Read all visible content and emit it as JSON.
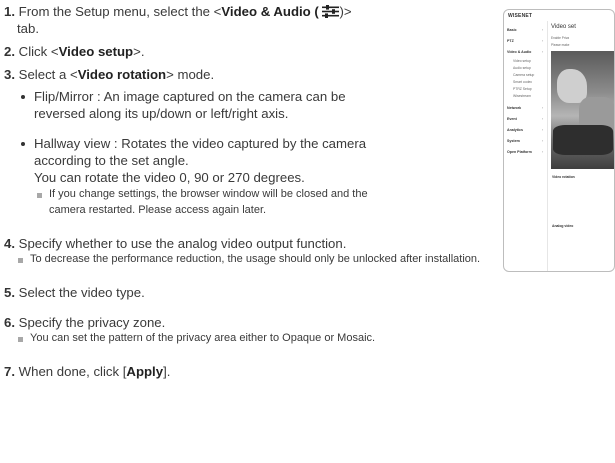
{
  "steps": [
    {
      "num": "1.",
      "pre": "From the Setup menu, select the <",
      "bold": "Video & Audio ( ",
      "post": ")>",
      "cont": "tab."
    },
    {
      "num": "2.",
      "pre": "Click <",
      "bold": "Video setup",
      "post": ">."
    },
    {
      "num": "3.",
      "pre": "Select a <",
      "bold": "Video rotation",
      "post": "> mode."
    },
    {
      "num": "4.",
      "text": "Specify whether to use the analog video output function."
    },
    {
      "num": "5.",
      "text": "Select the video type."
    },
    {
      "num": "6.",
      "text": "Specify the privacy zone."
    },
    {
      "num": "7.",
      "pre": "When done, click [",
      "bold": "Apply",
      "post": "]."
    }
  ],
  "bullets": [
    {
      "line1": "Flip/Mirror : An image captured on the camera can be",
      "line2": "reversed along its up/down or left/right axis."
    },
    {
      "line1": "Hallway view : Rotates the video captured by the camera",
      "line2": "according to the set angle.",
      "line3": "You can rotate the video 0, 90 or 270 degrees."
    }
  ],
  "notes": {
    "restart_1": "If you change settings, the browser window will be closed and the",
    "restart_2": "camera restarted. Please access again later.",
    "analog": "To decrease the performance reduction, the usage should only be unlocked after installation.",
    "privacy": "You can set the pattern of the privacy area either to Opaque or Mosaic."
  },
  "thumbnail": {
    "brand": "WISENET",
    "menu": [
      {
        "label": "Basic",
        "chev": "›"
      },
      {
        "label": "PTZ",
        "chev": "›"
      },
      {
        "label": "Video & Audio",
        "chev": "›"
      },
      {
        "label": "Network",
        "chev": "›"
      },
      {
        "label": "Event",
        "chev": "›"
      },
      {
        "label": "Analytics",
        "chev": "›"
      },
      {
        "label": "System",
        "chev": "›"
      },
      {
        "label": "Open Platform",
        "chev": "›"
      }
    ],
    "submenu": [
      "Video setup",
      "Audio setup",
      "Camera setup",
      "Smart codec",
      "PTRZ Setup",
      "Wisestream"
    ],
    "main_title": "Video set",
    "line1": "Enable Priva",
    "line2": "Please make",
    "label_rotation": "Video rotation",
    "label_analog": "Analog video"
  },
  "icon_colors": {
    "tune": "#222222"
  }
}
